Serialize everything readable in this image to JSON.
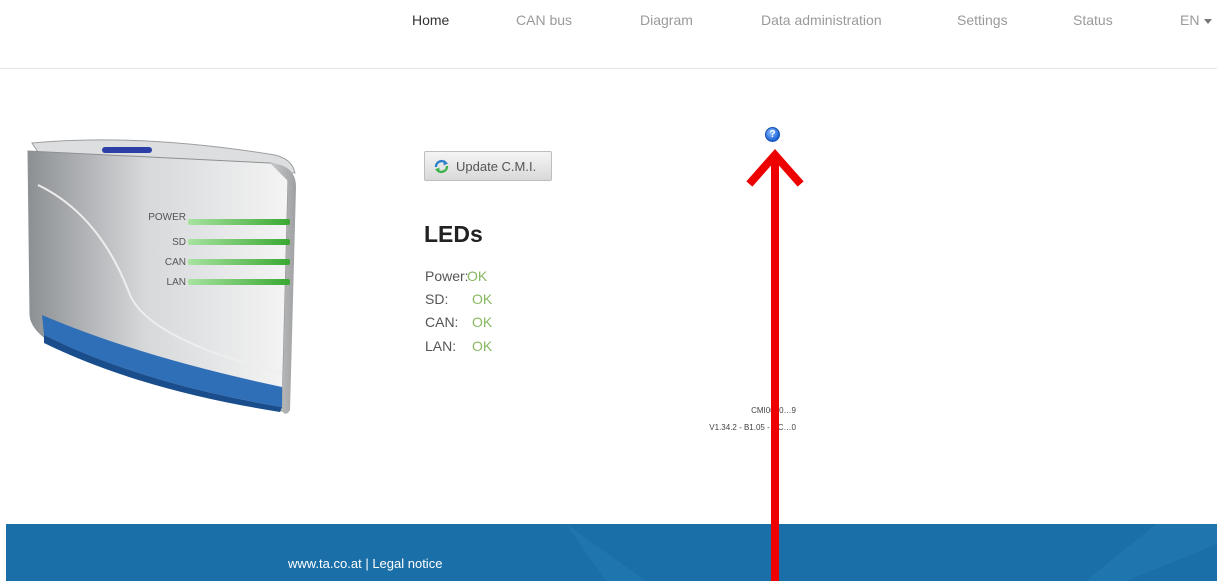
{
  "nav": {
    "items": [
      {
        "label": "Home"
      },
      {
        "label": "CAN bus"
      },
      {
        "label": "Diagram"
      },
      {
        "label": "Data administration"
      },
      {
        "label": "Settings"
      },
      {
        "label": "Status"
      }
    ],
    "active": "Home",
    "language": "EN"
  },
  "device": {
    "led_labels": [
      "POWER",
      "SD",
      "CAN",
      "LAN"
    ]
  },
  "main": {
    "update_button_label": "Update C.M.I.",
    "leds_title": "LEDs",
    "leds": [
      {
        "label": "Power:",
        "value": "OK"
      },
      {
        "label": "SD:",
        "value": "OK"
      },
      {
        "label": "CAN:",
        "value": "OK"
      },
      {
        "label": "LAN:",
        "value": "OK"
      }
    ],
    "help_glyph": "?",
    "version_line1": "CMI0000…9",
    "version_line2": "V1.34.2 - B1.05 - HC…0"
  },
  "footer": {
    "site_link": "www.ta.co.at",
    "separator": " | ",
    "legal_link": "Legal notice"
  },
  "colors": {
    "footer_bg": "#1b6fa8",
    "led_ok": "#88b860",
    "annotation_arrow": "#ee0000"
  },
  "icons": {
    "update": "refresh-icon",
    "help": "help-circle-icon"
  }
}
